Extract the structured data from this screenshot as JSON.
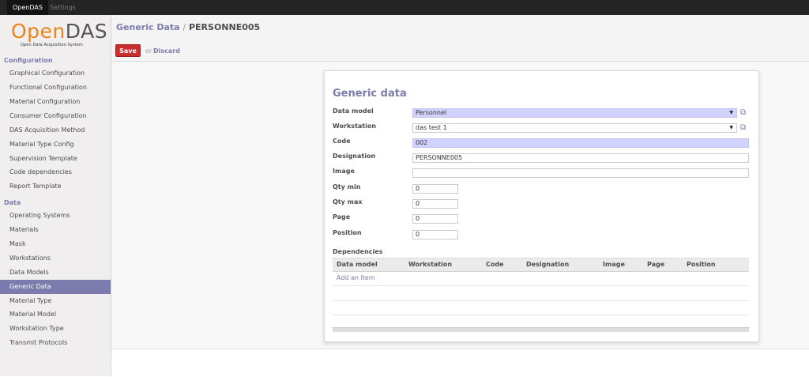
{
  "topbar": {
    "menus": [
      "OpenDAS",
      "Settings"
    ]
  },
  "logo": {
    "title_open": "Open",
    "title_das": "DAS",
    "subtitle": "Open Data Acquisition System"
  },
  "sidebar": {
    "sections": [
      {
        "title": "Configuration",
        "items": [
          "Graphical Configuration",
          "Functional Configuration",
          "Material Configuration",
          "Consumer Configuration",
          "DAS Acquisition Method",
          "Material Type Config",
          "Supervision Template",
          "Code dependencies",
          "Report Template"
        ]
      },
      {
        "title": "Data",
        "items": [
          "Operating Systems",
          "Materials",
          "Mask",
          "Workstations",
          "Data Models",
          "Generic Data",
          "Material Type",
          "Material Model",
          "Workstation Type",
          "Transmit Protocols"
        ]
      }
    ],
    "selected": "Generic Data"
  },
  "header": {
    "breadcrumb_parent": "Generic Data",
    "separator": "/",
    "current": "PERSONNE005",
    "save_label": "Save",
    "or_text": "or",
    "discard_label": "Discard"
  },
  "form": {
    "title": "Generic data",
    "fields": {
      "data_model": {
        "label": "Data model",
        "value": "Personnel"
      },
      "workstation": {
        "label": "Workstation",
        "value": "das test 1"
      },
      "code": {
        "label": "Code",
        "value": "002"
      },
      "designation": {
        "label": "Designation",
        "value": "PERSONNE005"
      },
      "image": {
        "label": "Image",
        "value": ""
      },
      "qty_min": {
        "label": "Qty min",
        "value": "0"
      },
      "qty_max": {
        "label": "Qty max",
        "value": "0"
      },
      "page": {
        "label": "Page",
        "value": "0"
      },
      "position": {
        "label": "Position",
        "value": "0"
      }
    },
    "dependencies": {
      "label": "Dependencies",
      "columns": [
        "Data model",
        "Workstation",
        "Code",
        "Designation",
        "Image",
        "Page",
        "Position"
      ],
      "add_item": "Add an item"
    }
  },
  "icons": {
    "dropdown": "caret-down-icon",
    "external": "external-link-icon"
  },
  "colors": {
    "accent": "#7c7bad",
    "save": "#c92d2d",
    "required_bg": "#d2d2ff"
  }
}
